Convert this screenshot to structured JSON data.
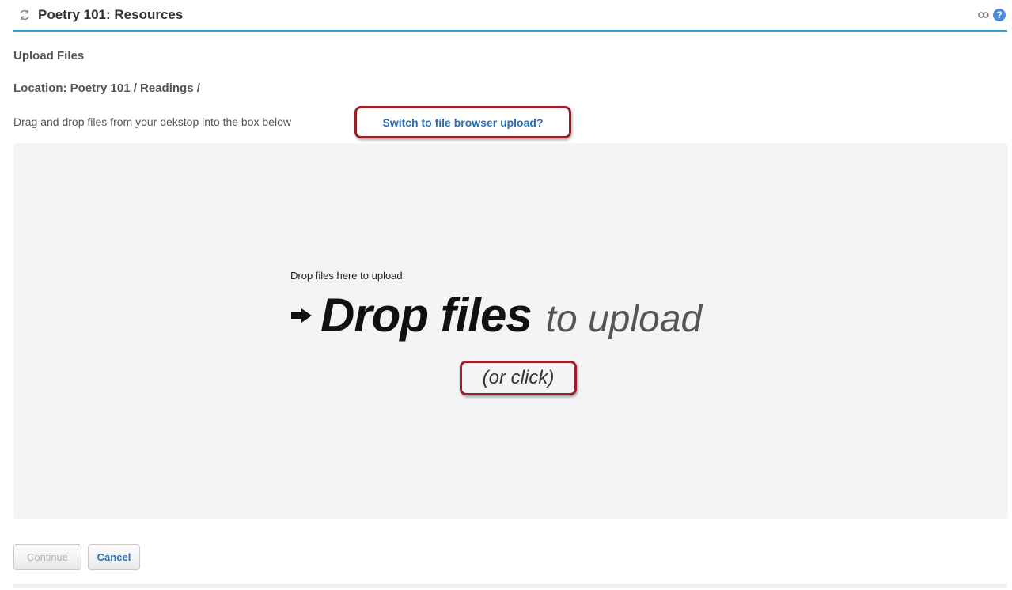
{
  "tool": {
    "title": "Poetry 101: Resources",
    "icons": [
      "reset-tool-icon",
      "link-icon",
      "help-icon"
    ],
    "help_glyph": "?"
  },
  "page": {
    "heading": "Upload Files",
    "location": "Location: Poetry 101 / Readings /",
    "instructions": "Drag and drop files from your dekstop into the box below",
    "switch_link": "Switch to file browser upload?"
  },
  "dropzone": {
    "small_text": "Drop files here to upload.",
    "big_bold": "Drop files",
    "big_light": "to upload",
    "click_text": "(or click)"
  },
  "buttons": {
    "continue": "Continue",
    "cancel": "Cancel"
  },
  "colors": {
    "accent": "#3d9ccf",
    "link": "#2a6fb5",
    "highlight": "#9a1f2a",
    "dropzone_bg": "#f4f4f6"
  }
}
